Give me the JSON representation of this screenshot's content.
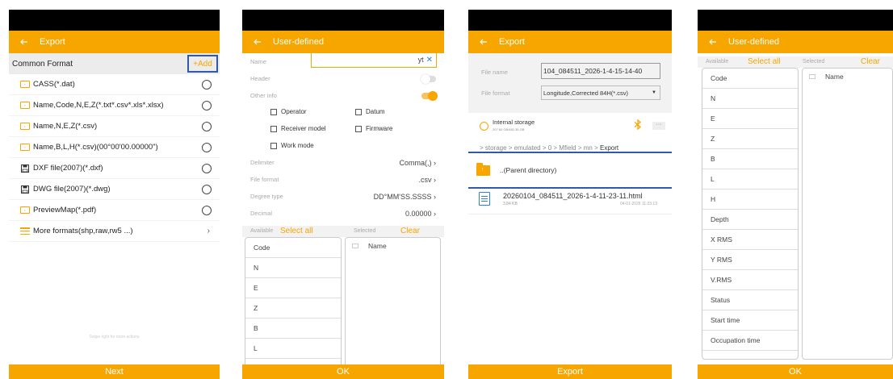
{
  "screen1": {
    "title": "Export",
    "header_label": "Common Format",
    "add_label": "+Add",
    "formats": [
      {
        "label": "CASS(*.dat)",
        "icon": "file-icon"
      },
      {
        "label": "Name,Code,N,E,Z(*.txt*.csv*.xls*.xlsx)",
        "icon": "file-icon"
      },
      {
        "label": "Name,N,E,Z(*.csv)",
        "icon": "file-icon"
      },
      {
        "label": "Name,B,L,H(*.csv)(00°00'00.00000\")",
        "icon": "file-icon"
      },
      {
        "label": "DXF file(2007)(*.dxf)",
        "icon": "disk-icon"
      },
      {
        "label": "DWG file(2007)(*.dwg)",
        "icon": "disk-icon"
      },
      {
        "label": "PreviewMap(*.pdf)",
        "icon": "file-icon"
      }
    ],
    "more_formats": "More formats(shp,raw,rw5 ...)",
    "swipe_hint": "Swipe right for more actions",
    "next_label": "Next"
  },
  "screen2": {
    "title": "User-defined",
    "name_label": "Name",
    "name_value": "yt",
    "header_label": "Header",
    "header_on": false,
    "other_info_label": "Other info",
    "other_info_on": true,
    "checkboxes": {
      "operator": "Operator",
      "datum": "Datum",
      "receiver_model": "Receiver model",
      "firmware": "Firmware",
      "work_mode": "Work mode"
    },
    "delimiter_label": "Delimiter",
    "delimiter_value": "Comma(,)",
    "file_format_label": "File format",
    "file_format_value": ".csv",
    "degree_type_label": "Degree type",
    "degree_type_value": "DD°MM'SS.SSSS",
    "decimal_label": "Decimal",
    "decimal_value": "0.00000",
    "available_label": "Available",
    "select_all_label": "Select all",
    "selected_label": "Selected",
    "clear_label": "Clear",
    "available_items": [
      "Code",
      "N",
      "E",
      "Z",
      "B",
      "L"
    ],
    "selected_items": [
      "Name"
    ],
    "ok_label": "OK"
  },
  "screen3": {
    "title": "Export",
    "file_name_label": "File name",
    "file_name_value": "104_084511_2026-1-4-15-14-40",
    "file_format_label": "File format",
    "file_format_value": "Longitude,Corrected 84H(*.csv)",
    "storage_name": "Internal storage",
    "storage_size": "207.60 GB/482.35 GB",
    "bluetooth_icon": "bluetooth-icon",
    "more_label": "···",
    "breadcrumb": "> storage > emulated > 0 > Mfield > mn >",
    "breadcrumb_current": "Export",
    "parent_dir": "..(Parent directory)",
    "file_entry_name": "20260104_084511_2026-1-4-11-23-11.html",
    "file_entry_size": "3.84 KB",
    "file_entry_date": "04-01-2026 11:23:13",
    "export_label": "Export",
    "accent_color": "#f7a600",
    "highlight_color": "#2e5aa8"
  },
  "screen4": {
    "title": "User-defined",
    "available_label": "Available",
    "select_all_label": "Select all",
    "selected_label": "Selected",
    "clear_label": "Clear",
    "available_items": [
      "Code",
      "N",
      "E",
      "Z",
      "B",
      "L",
      "H",
      "Depth",
      "X RMS",
      "Y RMS",
      "V.RMS",
      "Status",
      "Start time",
      "Occupation time"
    ],
    "selected_items": [
      "Name"
    ],
    "ok_label": "OK"
  }
}
